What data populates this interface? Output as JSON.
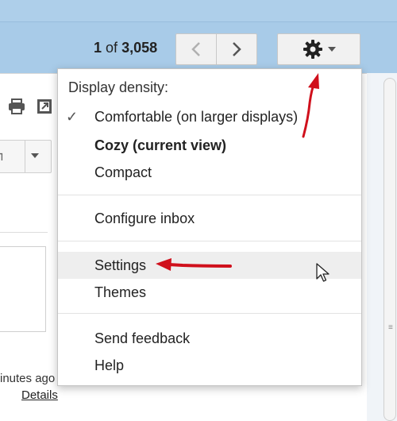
{
  "toolbar": {
    "pager_current": "1",
    "pager_of": "of",
    "pager_total": "3,058",
    "prev_icon": "chevron-left-icon",
    "next_icon": "chevron-right-icon",
    "settings_icon": "gear-icon"
  },
  "settings_menu": {
    "heading": "Display density:",
    "density_options": [
      {
        "label": "Comfortable (on larger displays)",
        "checked": true
      },
      {
        "label": "Cozy (current view)",
        "checked": false
      },
      {
        "label": "Compact",
        "checked": false
      }
    ],
    "configure_inbox": "Configure inbox",
    "settings": "Settings",
    "themes": "Themes",
    "send_feedback": "Send feedback",
    "help": "Help"
  },
  "message_pane": {
    "time_ago": "inutes ago",
    "details_link": "Details"
  },
  "colors": {
    "toolbar_bg": "#a8cbe8",
    "annotation_arrow": "#d0101c"
  }
}
